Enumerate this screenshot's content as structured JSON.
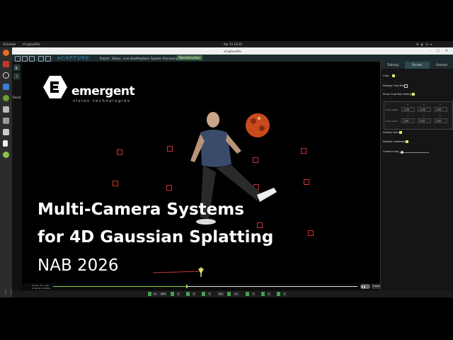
{
  "system": {
    "activities": "Activities",
    "app_name": "eCapturePro",
    "clock": "Apr 15  18:32",
    "tray": "⚙ ◐ ⏻ ▾"
  },
  "window": {
    "title": "eCapturePro",
    "controls": "– ▢ ✕"
  },
  "toolbar": {
    "brand": "eCAPTURE",
    "menus": [
      "Project",
      "Status",
      "Live View",
      "Playback",
      "System",
      "Processing",
      "Reconstruction"
    ]
  },
  "left_tools": {
    "btn1": "◧",
    "btn2": "↑",
    "reset_label": "Reset"
  },
  "scene": {
    "logo_text": "emergent",
    "logo_subtitle": "vision technologies",
    "title_line1": "Multi-Camera Systems",
    "title_line2": "for 4D Gaussian Splatting",
    "title_line3": "NAB 2026"
  },
  "timeline": {
    "frame_line1": "Frame: 49 / 100",
    "frame_line2": "# Splats: 230000",
    "progress": 0.44,
    "pause_label": "❚❚ ▢",
    "output_label": "Output Device"
  },
  "statusbar": {
    "items": [
      "Cu",
      "6/84",
      "0",
      "0",
      "0",
      "N/A",
      "1/1",
      "0",
      "0",
      "0"
    ]
  },
  "panel": {
    "tabs": [
      "Training",
      "Render",
      "General"
    ],
    "crop_label": "Crop",
    "display_crop_box_label": "Display Crop Box",
    "show_crop_box_settings_label": "Show Crop Box Settings",
    "crop_axis_headers": [
      "x",
      "y",
      "z"
    ],
    "crop_start_label": "Crop (start)",
    "crop_start": [
      "-1.00",
      "-0.55",
      "1.00"
    ],
    "crop_end_label": "Crop (end)",
    "crop_end": [
      "1.00",
      "0.45",
      "2.00"
    ],
    "display_axis_label": "Display Axis",
    "display_calibration_label": "Display calibration",
    "camera_size_label": "Camera size",
    "camera_size_value": 0.1
  },
  "colors": {
    "accent_green": "#8fd14f",
    "check_on": "#e3e36a",
    "camera_marker": "#cc3333"
  }
}
